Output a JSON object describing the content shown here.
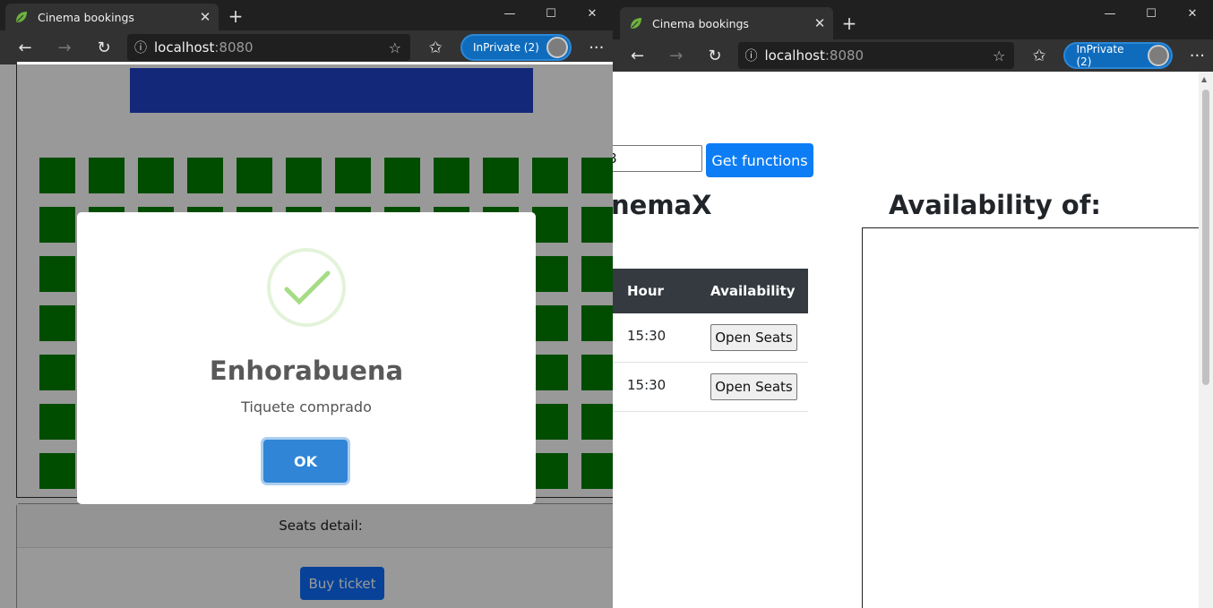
{
  "left_window": {
    "tab_title": "Cinema bookings",
    "address_host": "localhost",
    "address_port": ":8080",
    "inprivate_label": "InPrivate (2)",
    "seats_detail_label": "Seats detail:",
    "buy_ticket_label": "Buy ticket",
    "seat_color": "#008000",
    "seat_rows": 7,
    "seat_cols": 12,
    "screen_color": "#2244cc"
  },
  "modal": {
    "title": "Enhorabuena",
    "text": "Tiquete comprado",
    "ok_label": "OK",
    "icon": "success-check-icon"
  },
  "right_window": {
    "tab_title": "Cinema bookings",
    "address_host": "localhost",
    "address_port": ":8080",
    "inprivate_label": "InPrivate (2)",
    "input_value": "8",
    "get_functions_label": "Get functions",
    "cinema_heading": "nemaX",
    "availability_heading": "Availability of:",
    "table": {
      "headers": [
        "Hour",
        "Availability"
      ],
      "rows": [
        {
          "hour": "15:30",
          "action": "Open Seats"
        },
        {
          "hour": "15:30",
          "action": "Open Seats"
        }
      ]
    }
  },
  "colors": {
    "accent": "#0d7df5",
    "ok_button": "#3085d6",
    "table_header": "#343a40"
  }
}
